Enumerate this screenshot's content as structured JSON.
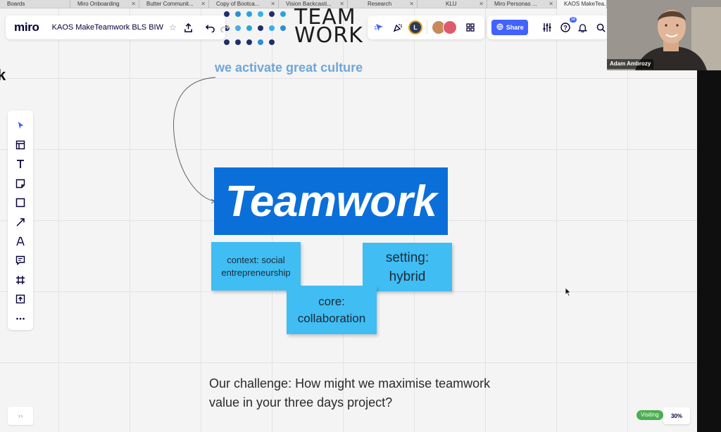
{
  "tabs": [
    {
      "label": "Boards"
    },
    {
      "label": "Miro Onboarding"
    },
    {
      "label": "Butter Communit..."
    },
    {
      "label": "Copy of Bootca..."
    },
    {
      "label": "Vision Backcasti..."
    },
    {
      "label": "Research"
    },
    {
      "label": "KLU"
    },
    {
      "label": "Miro Personas ..."
    },
    {
      "label": "KAOS MakeTea..."
    }
  ],
  "topbar": {
    "logo": "miro",
    "board_title": "KAOS MakeTeamwork BLS BIW"
  },
  "collaborators": {
    "initial": "L"
  },
  "share": {
    "label": "Share",
    "help_badge": "38"
  },
  "board": {
    "logo_text_line1": "TEAM",
    "logo_text_line2": "WORK",
    "slogan": "we activate great culture",
    "headline": "Teamwork",
    "sticky_context": "context: social\nentrepreneurship",
    "sticky_setting": "setting:\nhybrid",
    "sticky_core": "core:\ncollaboration",
    "challenge": "Our challenge: How might we maximise teamwork\nvalue in your three days project?",
    "edge_letter": "k"
  },
  "video": {
    "participant_name": "Adam Ambrozy"
  },
  "status": {
    "visiting_label": "Visiting",
    "zoom": "30%"
  },
  "colors": {
    "accent": "#4262ff",
    "headline_bg": "#0b6fd9",
    "sticky": "#40bdf2",
    "slogan": "#6fa6d8"
  }
}
